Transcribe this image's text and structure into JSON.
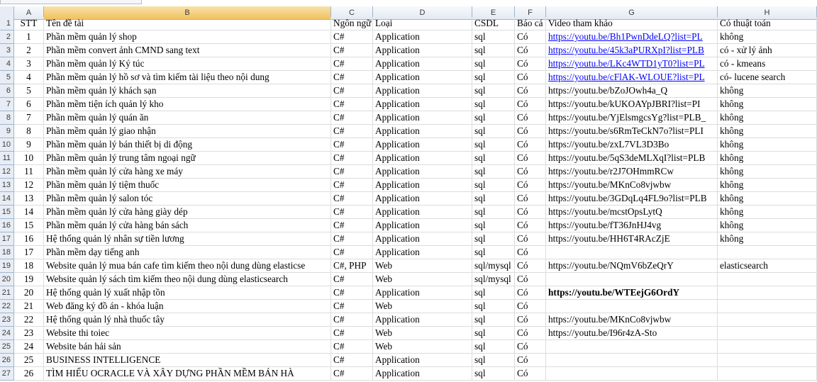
{
  "columns": [
    "A",
    "B",
    "C",
    "D",
    "E",
    "F",
    "G",
    "H"
  ],
  "header": {
    "stt": "STT",
    "ten": "Tên đề tài",
    "ngonngu": "Ngôn ngữ",
    "loai": "Loại",
    "csdl": "CSDL",
    "baocao": "Báo cá",
    "video": "Video tham khảo",
    "thuattoan": "Có thuật toán"
  },
  "row_numbers": [
    "1",
    "2",
    "3",
    "4",
    "5",
    "6",
    "7",
    "8",
    "9",
    "10",
    "11",
    "12",
    "13",
    "14",
    "15",
    "16",
    "17",
    "18",
    "19",
    "20",
    "21",
    "22",
    "23",
    "24",
    "25",
    "26",
    "27"
  ],
  "rows": [
    {
      "stt": "1",
      "ten": "Phần mềm quản lý shop",
      "ngonngu": "C#",
      "loai": "Application",
      "csdl": "sql",
      "baocao": "Có",
      "video": "https://youtu.be/Bh1PwnDdeLQ?list=PL",
      "thuattoan": "không",
      "link": true
    },
    {
      "stt": "2",
      "ten": "Phần mềm convert ảnh CMND sang text",
      "ngonngu": "C#",
      "loai": "Application",
      "csdl": "sql",
      "baocao": "Có",
      "video": "https://youtu.be/45k3aPURXpI?list=PLB",
      "thuattoan": "có - xử lý ảnh",
      "link": true
    },
    {
      "stt": "3",
      "ten": "Phần mềm quản lý Ký túc",
      "ngonngu": "C#",
      "loai": "Application",
      "csdl": "sql",
      "baocao": "Có",
      "video": "https://youtu.be/LKc4WTD1yT0?list=PL",
      "thuattoan": "có - kmeans",
      "link": true
    },
    {
      "stt": "4",
      "ten": "Phần mềm quản lý hồ sơ và tìm kiếm tài liệu theo nội dung",
      "ngonngu": "C#",
      "loai": "Application",
      "csdl": "sql",
      "baocao": "Có",
      "video": "https://youtu.be/cFlAK-WLOUE?list=PL",
      "thuattoan": "có- lucene search",
      "link": true
    },
    {
      "stt": "5",
      "ten": "Phần mềm quản lý khách sạn",
      "ngonngu": "C#",
      "loai": "Application",
      "csdl": "sql",
      "baocao": "Có",
      "video": "https://youtu.be/bZoJOwh4a_Q",
      "thuattoan": "không"
    },
    {
      "stt": "6",
      "ten": "Phần mềm tiện ích quản lý kho",
      "ngonngu": "C#",
      "loai": "Application",
      "csdl": "sql",
      "baocao": "Có",
      "video": "https://youtu.be/kUKOAYpJBRI?list=PI",
      "thuattoan": "không"
    },
    {
      "stt": "7",
      "ten": "Phần mềm quản lý quán ăn",
      "ngonngu": "C#",
      "loai": "Application",
      "csdl": "sql",
      "baocao": "Có",
      "video": "https://youtu.be/YjElsmgcsYg?list=PLB_",
      "thuattoan": "không"
    },
    {
      "stt": "8",
      "ten": "Phần mềm quản lý giao nhận",
      "ngonngu": "C#",
      "loai": "Application",
      "csdl": "sql",
      "baocao": "Có",
      "video": "https://youtu.be/s6RmTeCkN7o?list=PLI",
      "thuattoan": "không"
    },
    {
      "stt": "9",
      "ten": "Phần mềm quản lý bán thiết bị di động",
      "ngonngu": "C#",
      "loai": "Application",
      "csdl": "sql",
      "baocao": "Có",
      "video": "https://youtu.be/zxL7VL3D3Bo",
      "thuattoan": "không"
    },
    {
      "stt": "10",
      "ten": "Phần mềm quản lý trung tâm ngoại ngữ",
      "ngonngu": "C#",
      "loai": "Application",
      "csdl": "sql",
      "baocao": "Có",
      "video": "https://youtu.be/5qS3deMLXqI?list=PLB",
      "thuattoan": "không"
    },
    {
      "stt": "11",
      "ten": "Phần mềm quản lý cửa hàng xe máy",
      "ngonngu": "C#",
      "loai": "Application",
      "csdl": "sql",
      "baocao": "Có",
      "video": "https://youtu.be/r2J7OHmmRCw",
      "thuattoan": "không"
    },
    {
      "stt": "12",
      "ten": "Phần mềm quản lý tiệm thuốc",
      "ngonngu": "C#",
      "loai": "Application",
      "csdl": "sql",
      "baocao": "Có",
      "video": "https://youtu.be/MKnCo8vjwbw",
      "thuattoan": "không"
    },
    {
      "stt": "13",
      "ten": "Phần mềm quản lý salon tóc",
      "ngonngu": "C#",
      "loai": "Application",
      "csdl": "sql",
      "baocao": "Có",
      "video": "https://youtu.be/3GDqLq4FL9o?list=PLB",
      "thuattoan": "không"
    },
    {
      "stt": "14",
      "ten": "Phần mềm quản lý cửa hàng giày dép",
      "ngonngu": "C#",
      "loai": "Application",
      "csdl": "sql",
      "baocao": "Có",
      "video": "https://youtu.be/mcstOpsLytQ",
      "thuattoan": "không"
    },
    {
      "stt": "15",
      "ten": "Phần mềm quản lý cửa hàng bán sách",
      "ngonngu": "C#",
      "loai": "Application",
      "csdl": "sql",
      "baocao": "Có",
      "video": "https://youtu.be/fT36JnHJ4vg",
      "thuattoan": "không"
    },
    {
      "stt": "16",
      "ten": "Hệ thống quản lý nhân sự tiền lương",
      "ngonngu": "C#",
      "loai": "Application",
      "csdl": "sql",
      "baocao": "Có",
      "video": "https://youtu.be/HH6T4RAcZjE",
      "thuattoan": "không"
    },
    {
      "stt": "17",
      "ten": "Phần mềm dạy tiếng anh",
      "ngonngu": "C#",
      "loai": "Application",
      "csdl": "sql",
      "baocao": "Có",
      "video": "",
      "thuattoan": ""
    },
    {
      "stt": "18",
      "ten": "Website quản lý mua bán cafe tìm kiếm theo nội dung dùng elasticse",
      "ngonngu": "C#, PHP",
      "loai": "Web",
      "csdl": "sql/mysql",
      "baocao": "Có",
      "video": "https://youtu.be/NQmV6bZeQrY",
      "thuattoan": " elasticsearch"
    },
    {
      "stt": "19",
      "ten": "Website quản lý sách tìm kiếm theo nội dung dùng elasticsearch",
      "ngonngu": "C#",
      "loai": "Web",
      "csdl": "sql/mysql",
      "baocao": "Có",
      "video": "",
      "thuattoan": ""
    },
    {
      "stt": "20",
      "ten": "Hệ thống quản lý xuất nhập tồn",
      "ngonngu": "C#",
      "loai": "Application",
      "csdl": "sql",
      "baocao": "Có",
      "video": "https://youtu.be/WTEejG6OrdY",
      "thuattoan": "",
      "bold": true
    },
    {
      "stt": "21",
      "ten": "Web đăng ký đồ án - khóa luận",
      "ngonngu": "C#",
      "loai": "Web",
      "csdl": "sql",
      "baocao": "Có",
      "video": "",
      "thuattoan": ""
    },
    {
      "stt": "22",
      "ten": "Hệ thống quản lý nhà thuốc tây",
      "ngonngu": "C#",
      "loai": "Application",
      "csdl": "sql",
      "baocao": "Có",
      "video": "https://youtu.be/MKnCo8vjwbw",
      "thuattoan": ""
    },
    {
      "stt": "23",
      "ten": "Website thi toiec",
      "ngonngu": "C#",
      "loai": "Web",
      "csdl": "sql",
      "baocao": "Có",
      "video": "https://youtu.be/I96r4zA-Sto",
      "thuattoan": ""
    },
    {
      "stt": "24",
      "ten": "Website bán hải sản",
      "ngonngu": "C#",
      "loai": "Web",
      "csdl": "sql",
      "baocao": "Có",
      "video": "",
      "thuattoan": ""
    },
    {
      "stt": "25",
      "ten": "BUSINESS INTELLIGENCE",
      "ngonngu": "C#",
      "loai": "Application",
      "csdl": "sql",
      "baocao": "Có",
      "video": "",
      "thuattoan": ""
    },
    {
      "stt": "26",
      "ten": "TÌM HIỂU OCRACLE VÀ XÂY DỰNG PHẦN MỀM BÁN HÀ",
      "ngonngu": "C#",
      "loai": "Application",
      "csdl": "sql",
      "baocao": "Có",
      "video": "",
      "thuattoan": ""
    }
  ]
}
